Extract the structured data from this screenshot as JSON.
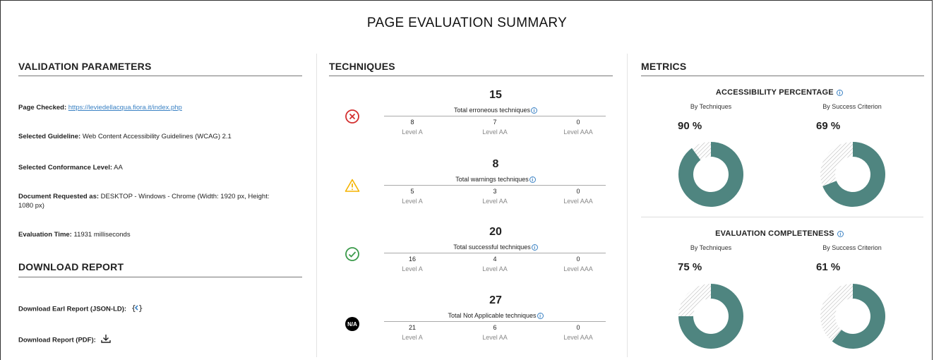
{
  "title": "PAGE EVALUATION SUMMARY",
  "validation": {
    "heading": "VALIDATION PARAMETERS",
    "page_checked_label": "Page Checked:",
    "page_checked_url": "https://leviedellacqua.fiora.it/index.php",
    "guideline_label": "Selected Guideline:",
    "guideline_value": "Web Content Accessibility Guidelines (WCAG) 2.1",
    "conformance_label": "Selected Conformance Level:",
    "conformance_value": "AA",
    "document_label": "Document Requested as:",
    "document_value": "DESKTOP - Windows - Chrome (Width: 1920 px, Height: 1080 px)",
    "eval_time_label": "Evaluation Time:",
    "eval_time_value": "11931 milliseconds"
  },
  "download": {
    "heading": "DOWNLOAD REPORT",
    "earl_label": "Download Earl Report (JSON-LD):",
    "pdf_label": "Download Report (PDF):"
  },
  "techniques": {
    "heading": "TECHNIQUES",
    "level_labels": [
      "Level A",
      "Level AA",
      "Level AAA"
    ],
    "groups": [
      {
        "icon": "error-icon",
        "total": "15",
        "caption": "Total erroneous techniques",
        "values": [
          "8",
          "7",
          "0"
        ]
      },
      {
        "icon": "warning-icon",
        "total": "8",
        "caption": "Total warnings techniques",
        "values": [
          "5",
          "3",
          "0"
        ]
      },
      {
        "icon": "success-icon",
        "total": "20",
        "caption": "Total successful techniques",
        "values": [
          "16",
          "4",
          "0"
        ]
      },
      {
        "icon": "not-applicable-icon",
        "icon_text": "N/A",
        "total": "27",
        "caption": "Total Not Applicable techniques",
        "values": [
          "21",
          "6",
          "0"
        ]
      }
    ]
  },
  "metrics": {
    "heading": "METRICS",
    "accessibility": {
      "title": "ACCESSIBILITY PERCENTAGE",
      "by_techniques_label": "By Techniques",
      "by_criterion_label": "By Success Criterion",
      "techniques_pct": "90 %",
      "criterion_pct": "69 %",
      "techniques_value": 0.9,
      "criterion_value": 0.69
    },
    "completeness": {
      "title": "EVALUATION COMPLETENESS",
      "by_techniques_label": "By Techniques",
      "by_criterion_label": "By Success Criterion",
      "techniques_pct": "75 %",
      "criterion_pct": "61 %",
      "techniques_value": 0.75,
      "criterion_value": 0.61
    }
  },
  "colors": {
    "donut_fill": "#4f8580",
    "hatch": "#bdbdbd",
    "error": "#d32f2f",
    "warning": "#f5b400",
    "success": "#3a9a4a",
    "link": "#3b82c4"
  }
}
